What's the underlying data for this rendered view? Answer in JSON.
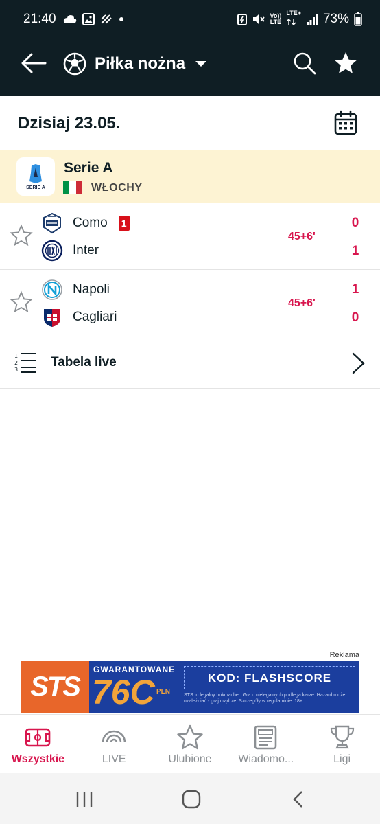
{
  "status_bar": {
    "time": "21:40",
    "battery_text": "73%",
    "volte_line1": "Vo))",
    "volte_line2": "LTE",
    "lte_plus": "LTE+"
  },
  "header": {
    "sport_title": "Piłka nożna"
  },
  "date_row": {
    "date_text": "Dzisiaj 23.05."
  },
  "league": {
    "name": "Serie A",
    "country": "WŁOCHY",
    "logo_text": "SERIE A",
    "flag_colors": [
      "#009246",
      "#ffffff",
      "#ce2b37"
    ]
  },
  "matches": [
    {
      "home": {
        "name": "Como",
        "red_cards": "1",
        "score": "0"
      },
      "away": {
        "name": "Inter",
        "score": "1"
      },
      "time": "45+6'"
    },
    {
      "home": {
        "name": "Napoli",
        "score": "1"
      },
      "away": {
        "name": "Cagliari",
        "score": "0"
      },
      "time": "45+6'"
    }
  ],
  "live_table": {
    "label": "Tabela live"
  },
  "ad": {
    "label": "Reklama",
    "logo": "STS",
    "headline": "GWARANTOWANE",
    "amount": "76C",
    "currency": "PLN",
    "code": "KOD: FLASHSCORE",
    "fine_print": "STS to legalny bukmacher. Gra u nielegalnych podlega karze. Hazard może uzależniać - graj mądrze. Szczegóły w regulaminie. 18+"
  },
  "bottom_nav": {
    "items": [
      {
        "label": "Wszystkie",
        "active": true
      },
      {
        "label": "LIVE"
      },
      {
        "label": "Ulubione"
      },
      {
        "label": "Wiadomo..."
      },
      {
        "label": "Ligi"
      }
    ]
  },
  "colors": {
    "header_bg": "#0f1e24",
    "accent": "#d8164e",
    "league_bg": "#fdf3d3",
    "red_card": "#d8101a",
    "ad_bg": "#1b3e9e",
    "ad_orange": "#e8662a"
  },
  "icons": {
    "back": "arrow-left-icon",
    "sport": "soccer-ball-icon",
    "dropdown": "caret-down-icon",
    "search": "search-icon",
    "favorites": "star-icon",
    "calendar": "calendar-icon",
    "match_favorite": "star-outline-icon",
    "table": "numbered-list-icon",
    "chevron": "chevron-right-icon"
  }
}
